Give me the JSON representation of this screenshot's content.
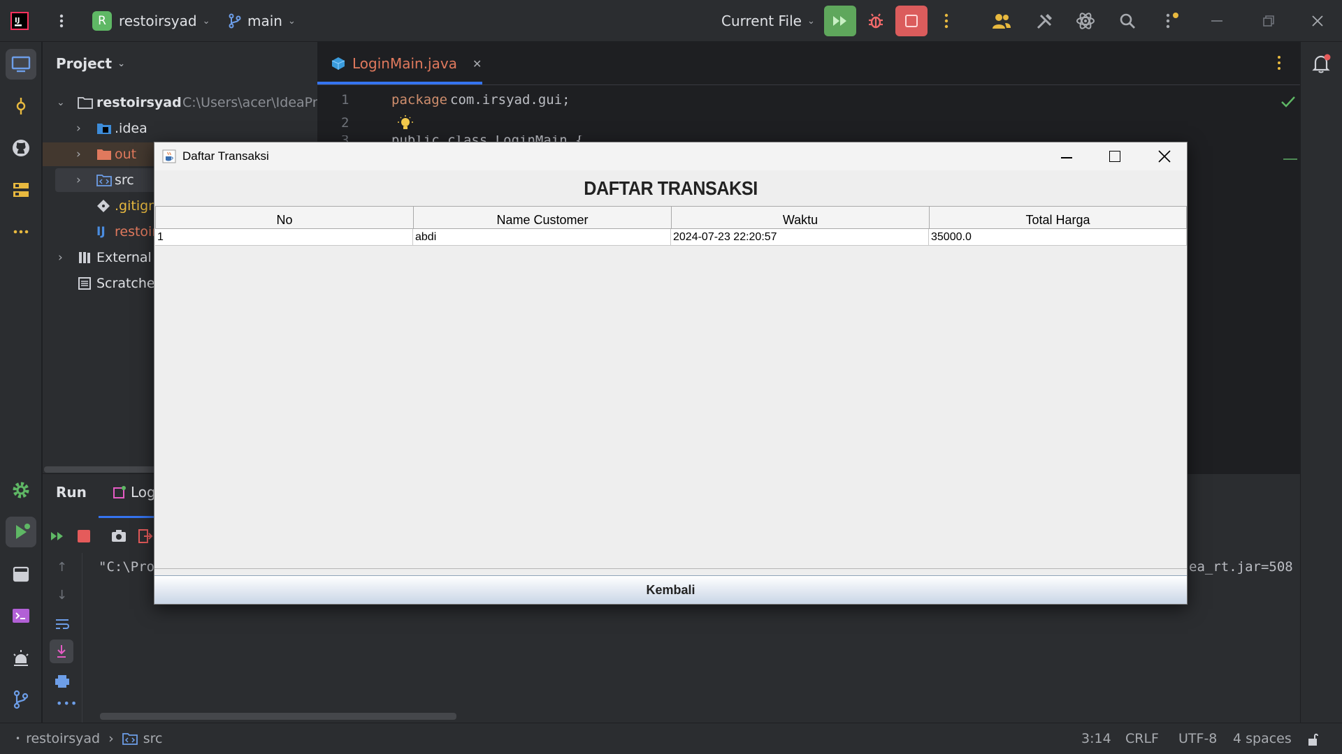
{
  "titlebar": {
    "project_initial": "R",
    "project_name": "restoirsyad",
    "branch": "main",
    "run_config": "Current File"
  },
  "project_panel": {
    "title": "Project",
    "root_name": "restoirsyad",
    "root_path": "C:\\Users\\acer\\IdeaPr",
    "items": [
      {
        "label": ".idea"
      },
      {
        "label": "out"
      },
      {
        "label": "src"
      },
      {
        "label": ".gitign"
      },
      {
        "label": "restoir"
      },
      {
        "label": "External"
      },
      {
        "label": "Scratche"
      }
    ]
  },
  "editor": {
    "tab_label": "LoginMain.java",
    "lines": [
      {
        "number": "1",
        "keyword": "package",
        "text": " com.irsyad.gui;"
      },
      {
        "number": "2"
      },
      {
        "number": "3",
        "text": "public class LoginMain {"
      }
    ]
  },
  "run_panel": {
    "tab_run": "Run",
    "tab_log": "Log",
    "console_left": "\"C:\\Pro",
    "console_right": "ea_rt.jar=508"
  },
  "statusbar": {
    "crumb_project": "restoirsyad",
    "crumb_folder": "src",
    "position": "3:14",
    "line_sep": "CRLF",
    "encoding": "UTF-8",
    "indent": "4 spaces"
  },
  "dialog": {
    "title": "Daftar Transaksi",
    "heading": "DAFTAR TRANSAKSI",
    "columns": [
      "No",
      "Name Customer",
      "Waktu",
      "Total Harga"
    ],
    "rows": [
      [
        "1",
        "abdi",
        "2024-07-23 22:20:57",
        "35000.0"
      ]
    ],
    "button_label": "Kembali"
  }
}
